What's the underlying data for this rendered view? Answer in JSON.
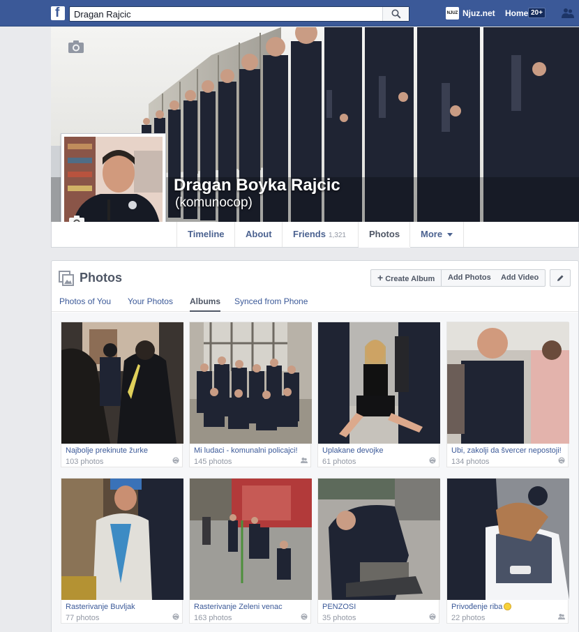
{
  "topbar": {
    "search_value": "Dragan Rajcic",
    "bookmark_badge": "NJUZ",
    "bookmark_label": "Njuz.net",
    "home_label": "Home",
    "home_count": "20+"
  },
  "profile": {
    "name": "Dragan Boyka Rajcic",
    "alternate_name": "(komunocop)"
  },
  "nav": {
    "timeline": "Timeline",
    "about": "About",
    "friends": "Friends",
    "friends_count": "1,321",
    "photos": "Photos",
    "more": "More"
  },
  "photos": {
    "title": "Photos",
    "create_album": "Create Album",
    "add_photos": "Add Photos",
    "add_video": "Add Video",
    "tabs": [
      "Photos of You",
      "Your Photos",
      "Albums",
      "Synced from Phone"
    ]
  },
  "albums": [
    {
      "title": "Najbolje prekinute žurke",
      "count": "103 photos",
      "privacy": "public"
    },
    {
      "title": "Mi ludaci - komunalni policajci!",
      "count": "145 photos",
      "privacy": "friends"
    },
    {
      "title": "Uplakane devojke",
      "count": "61 photos",
      "privacy": "public"
    },
    {
      "title": "Ubi, zakolji da švercer nepostoji!",
      "count": "134 photos",
      "privacy": "public"
    },
    {
      "title": "Rasterivanje Buvljak",
      "count": "77 photos",
      "privacy": "public"
    },
    {
      "title": "Rasterivanje Zeleni venac",
      "count": "163 photos",
      "privacy": "public"
    },
    {
      "title": "PENZOSI",
      "count": "35 photos",
      "privacy": "public"
    },
    {
      "title": "Privođenje riba",
      "count": "22 photos",
      "privacy": "friends"
    }
  ],
  "colors": {
    "brand": "#3b5998",
    "link": "#3b5998",
    "muted": "#9197a3",
    "uniform": "#1f2433"
  }
}
